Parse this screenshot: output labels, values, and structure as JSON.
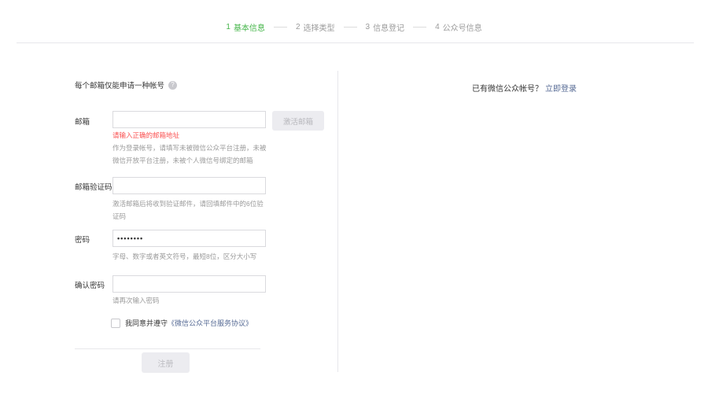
{
  "colors": {
    "accent_green": "#44b549",
    "link_blue": "#576b95",
    "error_red": "#fa5151"
  },
  "stepper": {
    "steps": [
      {
        "num": "1",
        "label": "基本信息",
        "active": true
      },
      {
        "num": "2",
        "label": "选择类型",
        "active": false
      },
      {
        "num": "3",
        "label": "信息登记",
        "active": false
      },
      {
        "num": "4",
        "label": "公众号信息",
        "active": false
      }
    ]
  },
  "form": {
    "notice": "每个邮箱仅能申请一种帐号",
    "help_icon": "?",
    "email": {
      "label": "邮箱",
      "value": "",
      "activate_button": "激活邮箱",
      "error": "请输入正确的邮箱地址",
      "hint": "作为登录帐号，请填写未被微信公众平台注册，未被微信开放平台注册，未被个人微信号绑定的邮箱"
    },
    "email_code": {
      "label": "邮箱验证码",
      "value": "",
      "hint": "激活邮箱后将收到验证邮件，请回填邮件中的6位验证码"
    },
    "password": {
      "label": "密码",
      "value": "••••••••",
      "hint": "字母、数字或者英文符号，最短8位，区分大小写"
    },
    "confirm_password": {
      "label": "确认密码",
      "value": "",
      "hint": "请再次输入密码"
    },
    "agreement": {
      "prefix": "我同意并遵守",
      "link": "《微信公众平台服务协议》"
    },
    "submit": "注册"
  },
  "aside": {
    "text": "已有微信公众帐号？",
    "link": "立即登录"
  }
}
